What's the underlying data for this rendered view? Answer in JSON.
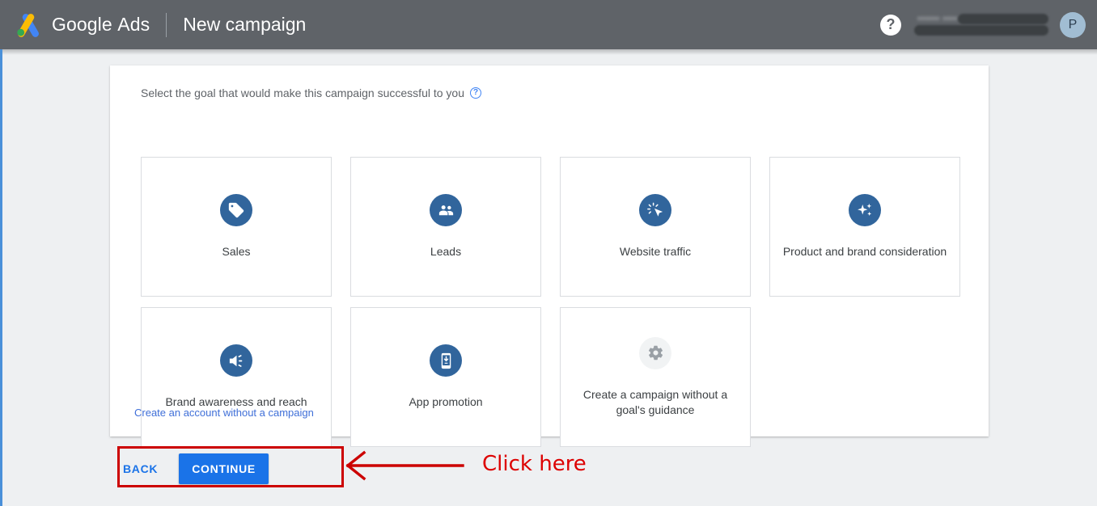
{
  "header": {
    "brand_google": "Google",
    "brand_ads": "Ads",
    "page_title": "New campaign",
    "help_glyph": "?",
    "account_redacted": "••••••  •••• ••••",
    "avatar_initial": "P",
    "bg_color": "#5f6368"
  },
  "panel": {
    "prompt": "Select the goal that would make this campaign successful to you",
    "prompt_help_glyph": "?",
    "no_campaign_link": "Create an account without a campaign",
    "link_color": "#3f6fd8"
  },
  "goals": [
    {
      "label": "Sales",
      "icon": "price-tag-icon",
      "style": "blue"
    },
    {
      "label": "Leads",
      "icon": "people-icon",
      "style": "blue"
    },
    {
      "label": "Website traffic",
      "icon": "cursor-click-icon",
      "style": "blue"
    },
    {
      "label": "Product and brand consideration",
      "icon": "sparkles-icon",
      "style": "blue"
    },
    {
      "label": "Brand awareness and reach",
      "icon": "speaker-icon",
      "style": "blue"
    },
    {
      "label": "App promotion",
      "icon": "mobile-download-icon",
      "style": "blue"
    },
    {
      "label": "Create a campaign without a goal's guidance",
      "icon": "gear-icon",
      "style": "muted"
    }
  ],
  "annotation": {
    "text": "Click here",
    "color": "#dd0000"
  },
  "footer": {
    "back_label": "BACK",
    "continue_label": "CONTINUE",
    "accent_color": "#1a73e8"
  }
}
